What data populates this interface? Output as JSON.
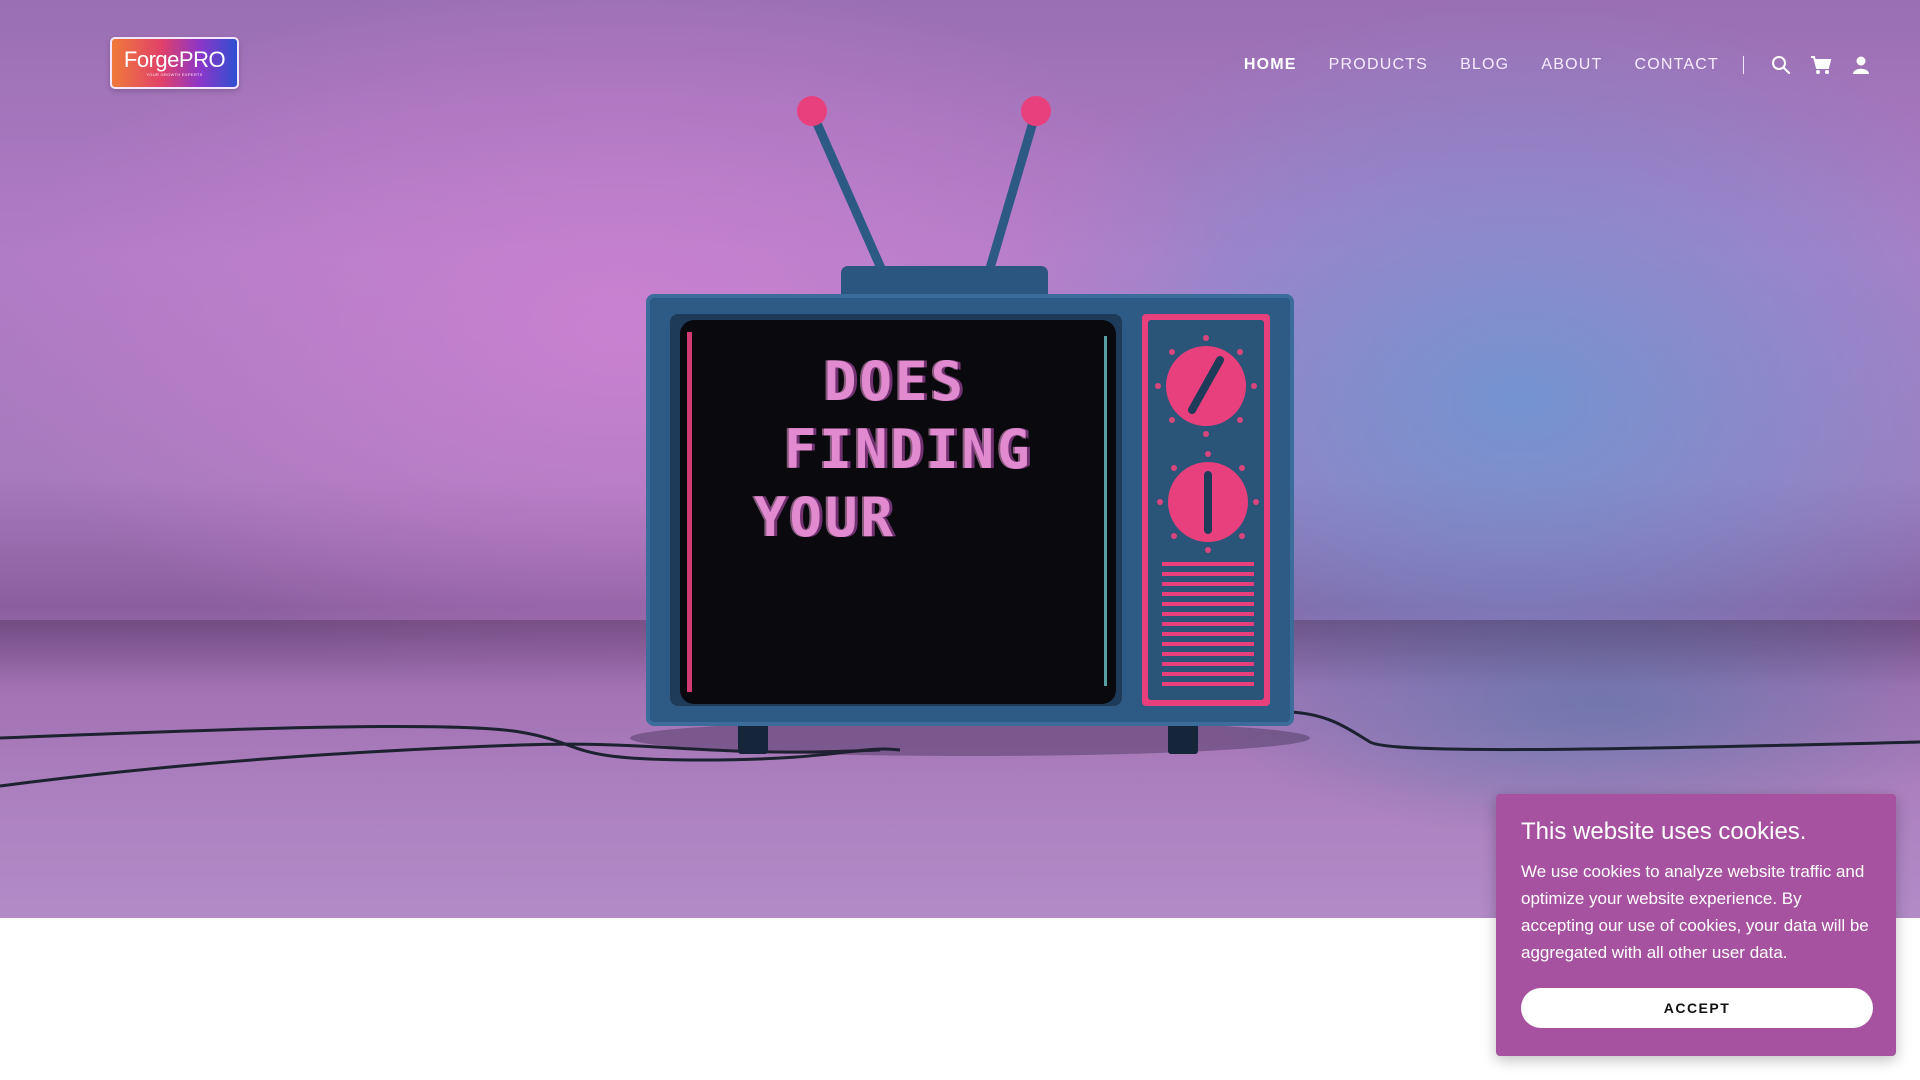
{
  "header": {
    "logo_text": "ForgePRO",
    "logo_tagline": "YOUR GROWTH EXPERTS",
    "nav": [
      {
        "label": "HOME"
      },
      {
        "label": "PRODUCTS"
      },
      {
        "label": "BLOG"
      },
      {
        "label": "ABOUT"
      },
      {
        "label": "CONTACT"
      }
    ],
    "icons": [
      "search-icon",
      "cart-icon",
      "account-icon"
    ]
  },
  "hero": {
    "screen_lines": [
      "DOES",
      "FINDING",
      "YOUR"
    ]
  },
  "cookie": {
    "title": "This website uses cookies.",
    "body": "We use cookies to analyze website traffic and optimize your website experience. By accepting our use of cookies, your data will be aggregated with all other user data.",
    "accept_label": "ACCEPT"
  },
  "colors": {
    "cookie_bg": "#a652a0",
    "tv_body": "#2e5a86",
    "accent_pink": "#e8407c"
  }
}
